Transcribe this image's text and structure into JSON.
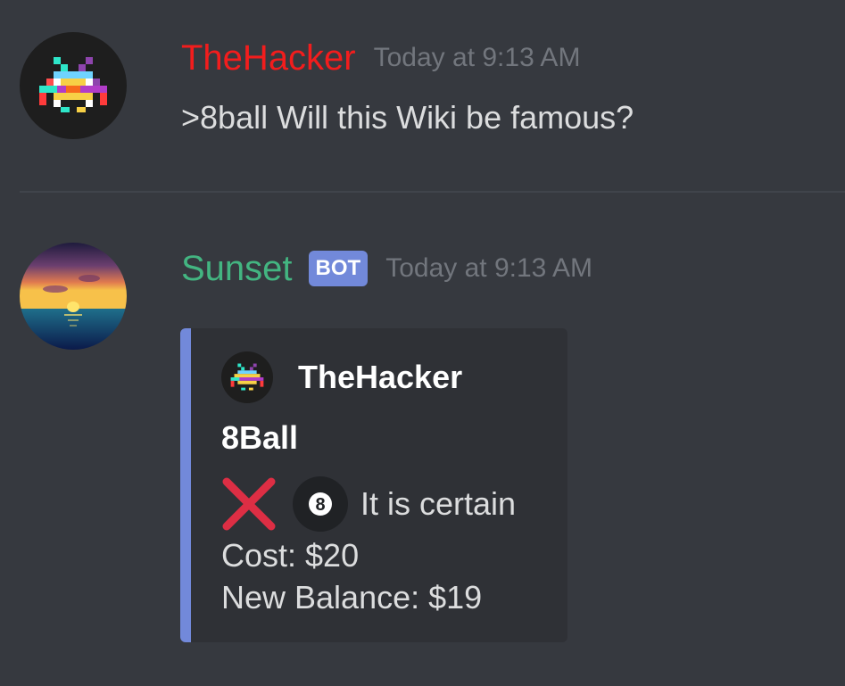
{
  "messages": [
    {
      "username": "TheHacker",
      "username_color": "#f21d1d",
      "timestamp": "Today at 9:13 AM",
      "content": ">8ball Will this Wiki be famous?",
      "avatar": "space-invader-icon"
    },
    {
      "username": "Sunset",
      "username_color": "#43b581",
      "badge": "BOT",
      "timestamp": "Today at 9:13 AM",
      "avatar": "sunset-icon",
      "embed": {
        "accent_color": "#7289da",
        "author_name": "TheHacker",
        "title": "8Ball",
        "answer_icons": [
          "cross-mark-icon",
          "eight-ball-icon"
        ],
        "answer_text": "It is certain",
        "cost_line": "Cost: $20",
        "balance_line": "New Balance: $19"
      }
    }
  ]
}
